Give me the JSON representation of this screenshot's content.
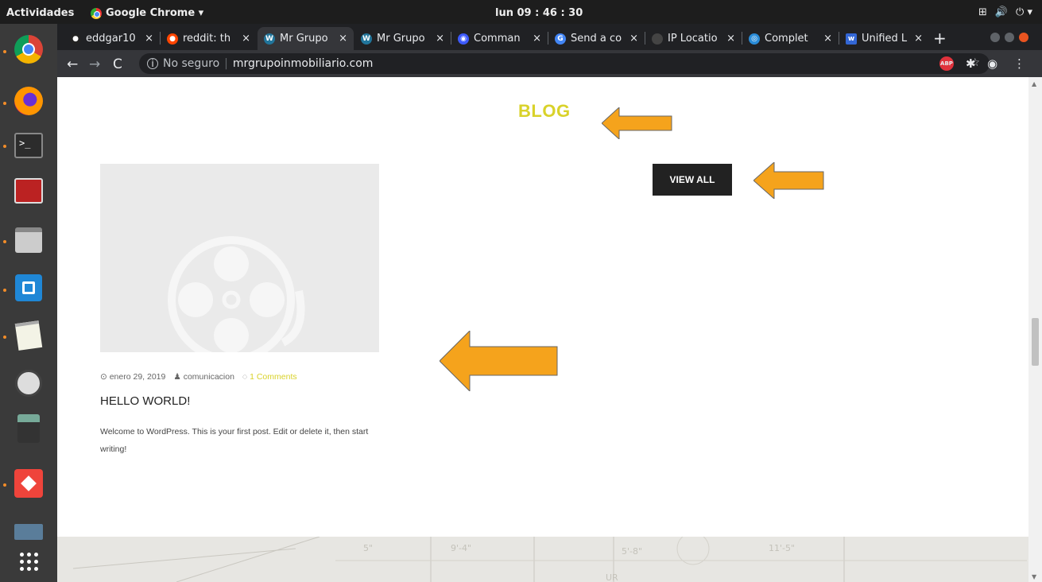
{
  "topbar": {
    "activities": "Actividades",
    "app_name": "Google Chrome ▾",
    "clock": "lun 09 : 46 : 30",
    "tray": [
      "⊞",
      "🔊",
      "⏻ ▾"
    ]
  },
  "dock": {
    "items": [
      "chrome",
      "firefox",
      "terminal",
      "remote-desktop",
      "files",
      "virtualbox",
      "text-editor",
      "software-updater",
      "calculator",
      "anydesk",
      "screenshot",
      "apps-grid"
    ]
  },
  "tabs": [
    {
      "label": "eddgar10",
      "icon": "github-icon",
      "color": "#222"
    },
    {
      "label": "reddit: th",
      "icon": "reddit-icon",
      "color": "#ff4500"
    },
    {
      "label": "Mr Grupo",
      "icon": "wordpress-icon",
      "color": "#21759b",
      "active": true
    },
    {
      "label": "Mr Grupo",
      "icon": "wordpress-icon",
      "color": "#21759b"
    },
    {
      "label": "Comman",
      "icon": "command-icon",
      "color": "#3d5afe"
    },
    {
      "label": "Send a co",
      "icon": "google-icon",
      "color": "#4285f4"
    },
    {
      "label": "IP Locatio",
      "icon": "ip-icon",
      "color": "#555"
    },
    {
      "label": "Complet",
      "icon": "globe-icon",
      "color": "#2a8cd8"
    },
    {
      "label": "Unified L",
      "icon": "w-icon",
      "color": "#3367d6"
    }
  ],
  "toolbar": {
    "security": "No seguro",
    "url": "mrgrupoinmobiliario.com"
  },
  "page": {
    "blog_title": "BLOG",
    "view_all": "VIEW ALL",
    "post": {
      "date": "enero 29, 2019",
      "author": "comunicacion",
      "comments": "1 Comments",
      "title": "HELLO WORLD!",
      "excerpt": "Welcome to WordPress. This is your first post. Edit or delete it, then start writing!"
    }
  },
  "colors": {
    "accent": "#d9d22a",
    "arrow": "#f5a31c",
    "button_bg": "#222222"
  }
}
